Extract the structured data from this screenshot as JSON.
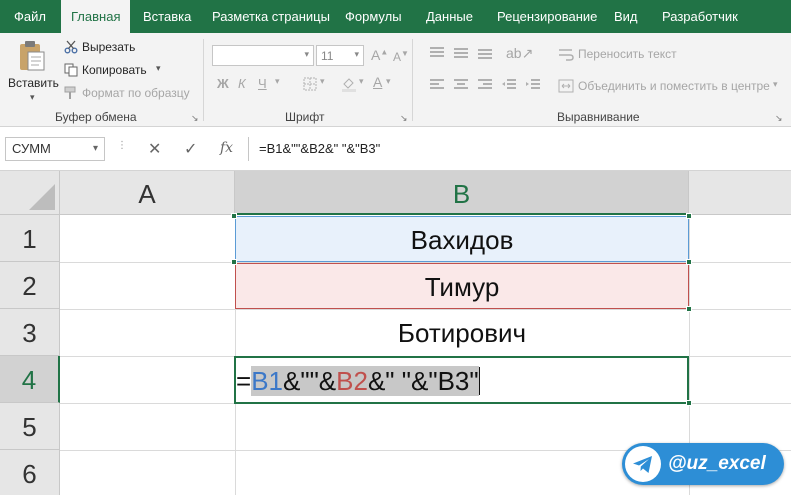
{
  "ribbon": {
    "tabs": [
      {
        "label": "Файл"
      },
      {
        "label": "Главная"
      },
      {
        "label": "Вставка"
      },
      {
        "label": "Разметка страницы"
      },
      {
        "label": "Формулы"
      },
      {
        "label": "Данные"
      },
      {
        "label": "Рецензирование"
      },
      {
        "label": "Вид"
      },
      {
        "label": "Разработчик"
      }
    ],
    "active_tab": "Главная",
    "clipboard": {
      "paste": "Вставить",
      "cut": "Вырезать",
      "copy": "Копировать",
      "format_painter": "Формат по образцу",
      "group_label": "Буфер обмена"
    },
    "font": {
      "font_size": "11",
      "bold": "Ж",
      "italic": "К",
      "underline": "Ч",
      "group_label": "Шрифт"
    },
    "alignment": {
      "wrap_text": "Переносить текст",
      "merge_center": "Объединить и поместить в центре",
      "group_label": "Выравнивание"
    }
  },
  "formula_bar": {
    "name_box": "СУММ",
    "fx": "fx",
    "formula": "=B1&\"\"&B2&\"  \"&\"B3\""
  },
  "grid": {
    "columns": [
      "A",
      "B"
    ],
    "rows": [
      "1",
      "2",
      "3",
      "4",
      "5",
      "6"
    ],
    "cells": {
      "B1": "Вахидов",
      "B2": "Тимур",
      "B3": "Ботирович"
    },
    "editing_cell": {
      "eq": "=",
      "ref1": "B1",
      "part1": "&\"\"&",
      "ref2": "B2",
      "part2": "&\"  \"&\"B3\""
    },
    "colors": {
      "ref1": "#3c78c8",
      "ref2": "#c0504d",
      "accent": "#217346"
    }
  },
  "watermark": {
    "text": "@uz_excel",
    "color": "#2d8ed6"
  }
}
